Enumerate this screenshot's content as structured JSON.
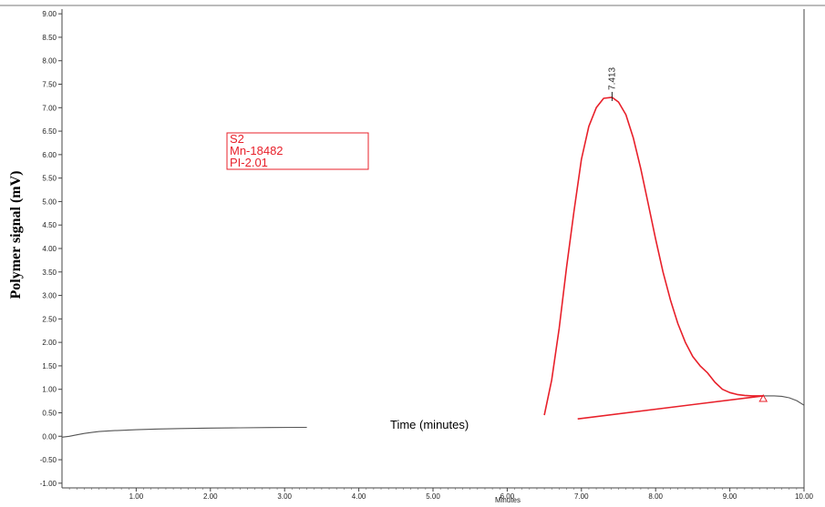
{
  "chart_data": {
    "type": "line",
    "ylabel": "Polymer signal (mV)",
    "xlabel": "Minutes",
    "annotation": "Time (minutes)",
    "xlim": [
      0.0,
      10.0
    ],
    "ylim": [
      -1.1,
      9.1
    ],
    "x_ticks": [
      1.0,
      2.0,
      3.0,
      4.0,
      5.0,
      6.0,
      7.0,
      8.0,
      9.0,
      10.0
    ],
    "x_tick_labels": [
      "1.00",
      "2.00",
      "3.00",
      "4.00",
      "5.00",
      "6.00",
      "7.00",
      "8.00",
      "9.00",
      "10.00"
    ],
    "y_ticks": [
      -1.0,
      -0.5,
      0.0,
      0.5,
      1.0,
      1.5,
      2.0,
      2.5,
      3.0,
      3.5,
      4.0,
      4.5,
      5.0,
      5.5,
      6.0,
      6.5,
      7.0,
      7.5,
      8.0,
      8.5,
      9.0
    ],
    "y_tick_labels": [
      "-1.00",
      "-0.50",
      "0.00",
      "0.50",
      "1.00",
      "1.50",
      "2.00",
      "2.50",
      "3.00",
      "3.50",
      "4.00",
      "4.50",
      "5.00",
      "5.50",
      "6.00",
      "6.50",
      "7.00",
      "7.50",
      "8.00",
      "8.50",
      "9.00"
    ],
    "legend_box": {
      "lines": [
        "S2",
        "Mn-18482",
        "PI-2.01"
      ],
      "color": "#e8202a"
    },
    "peak": {
      "x": 7.413,
      "y": 7.22,
      "label": "7.413"
    },
    "series": [
      {
        "color": "#555555",
        "x": [
          0.0,
          0.1,
          0.2,
          0.3,
          0.4,
          0.5,
          0.7,
          1.0,
          1.3,
          1.6,
          2.0,
          2.4,
          2.8,
          3.2,
          3.3
        ],
        "y": [
          -0.02,
          0.0,
          0.03,
          0.06,
          0.08,
          0.1,
          0.12,
          0.14,
          0.155,
          0.165,
          0.175,
          0.18,
          0.185,
          0.19,
          0.19
        ]
      },
      {
        "color": "#e8202a",
        "x": [
          6.5,
          6.6,
          6.7,
          6.8,
          6.9,
          7.0,
          7.1,
          7.2,
          7.3,
          7.413,
          7.5,
          7.6,
          7.7,
          7.8,
          7.9,
          8.0,
          8.1,
          8.2,
          8.3,
          8.4,
          8.5,
          8.6,
          8.7,
          8.8,
          8.9,
          9.0,
          9.1,
          9.2,
          9.3,
          9.45
        ],
        "y": [
          0.45,
          1.2,
          2.3,
          3.6,
          4.8,
          5.9,
          6.6,
          7.0,
          7.2,
          7.22,
          7.12,
          6.85,
          6.35,
          5.7,
          4.95,
          4.2,
          3.5,
          2.9,
          2.4,
          2.0,
          1.7,
          1.5,
          1.35,
          1.15,
          1.0,
          0.93,
          0.89,
          0.87,
          0.86,
          0.86
        ]
      },
      {
        "color": "#555555",
        "x": [
          9.45,
          9.6,
          9.7,
          9.8,
          9.9,
          10.0
        ],
        "y": [
          0.86,
          0.86,
          0.85,
          0.82,
          0.76,
          0.66
        ]
      },
      {
        "color": "#e8202a",
        "x": [
          6.95,
          9.45
        ],
        "y": [
          0.37,
          0.86
        ]
      }
    ],
    "baseline_marker": {
      "x": 9.45,
      "y": 0.82,
      "shape": "triangle"
    },
    "grid": false
  }
}
